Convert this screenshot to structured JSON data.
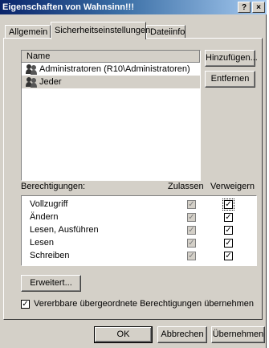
{
  "window": {
    "title": "Eigenschaften von Wahnsinn!!!",
    "help_button": "?",
    "close_button": "×"
  },
  "tabs": [
    {
      "label": "Allgemein"
    },
    {
      "label": "Sicherheitseinstellungen"
    },
    {
      "label": "Dateiinfo"
    }
  ],
  "users": {
    "header": "Name",
    "items": [
      {
        "label": "Administratoren (R10\\Administratoren)",
        "icon": "user-group-icon"
      },
      {
        "label": "Jeder",
        "icon": "user-group-icon",
        "selected": true
      }
    ],
    "add_button": "Hinzufügen...",
    "remove_button": "Entfernen"
  },
  "permissions": {
    "label": "Berechtigungen:",
    "allow_header": "Zulassen",
    "deny_header": "Verweigern",
    "rows": [
      {
        "name": "Vollzugriff",
        "allow": true,
        "deny": true
      },
      {
        "name": "Ändern",
        "allow": true,
        "deny": true
      },
      {
        "name": "Lesen, Ausführen",
        "allow": true,
        "deny": true
      },
      {
        "name": "Lesen",
        "allow": true,
        "deny": true
      },
      {
        "name": "Schreiben",
        "allow": true,
        "deny": true
      }
    ]
  },
  "advanced_button": "Erweitert...",
  "inherit_checkbox": {
    "label": "Vererbbare übergeordnete Berechtigungen übernehmen",
    "checked": true
  },
  "footer": {
    "ok": "OK",
    "cancel": "Abbrechen",
    "apply": "Übernehmen"
  },
  "colors": {
    "face": "#d4d0c8",
    "title_start": "#0a246a",
    "title_end": "#a6caf0"
  }
}
